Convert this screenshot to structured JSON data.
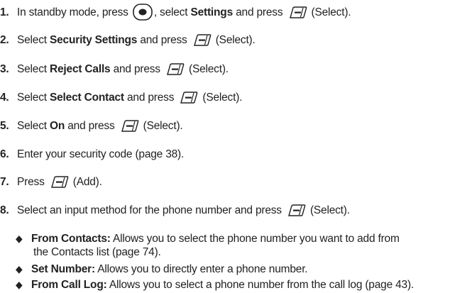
{
  "steps": [
    {
      "num": "1.",
      "pre": "In standby mode, press",
      "mid": ", select ",
      "bold": "Settings",
      "post": " and press",
      "tail": "(Select)."
    },
    {
      "num": "2.",
      "pre": "Select ",
      "bold": "Security Settings",
      "post": " and press",
      "tail": "(Select)."
    },
    {
      "num": "3.",
      "pre": "Select ",
      "bold": "Reject Calls",
      "post": " and press",
      "tail": "(Select)."
    },
    {
      "num": "4.",
      "pre": "Select ",
      "bold": "Select Contact",
      "post": " and press",
      "tail": "(Select)."
    },
    {
      "num": "5.",
      "pre": "Select ",
      "bold": "On",
      "post": " and press",
      "tail": "(Select)."
    },
    {
      "num": "6.",
      "text": "Enter your security code (page 38)."
    },
    {
      "num": "7.",
      "pre": "Press",
      "tail": "(Add)."
    },
    {
      "num": "8.",
      "pre": "Select an input method for the phone number and press",
      "tail": "(Select)."
    }
  ],
  "options": [
    {
      "bold": "From Contacts:",
      "text": " Allows you to select the phone number you want to add from",
      "cont": "the Contacts list (page 74)."
    },
    {
      "bold": "Set Number:",
      "text": " Allows you to directly enter a phone number."
    },
    {
      "bold": "From Call Log:",
      "text": " Allows you to select a phone number from the call log (page 43)."
    }
  ],
  "icons": {
    "end_key": "end-key-icon",
    "soft_key": "left-soft-key-icon",
    "bullet": "diamond-bullet-icon"
  }
}
